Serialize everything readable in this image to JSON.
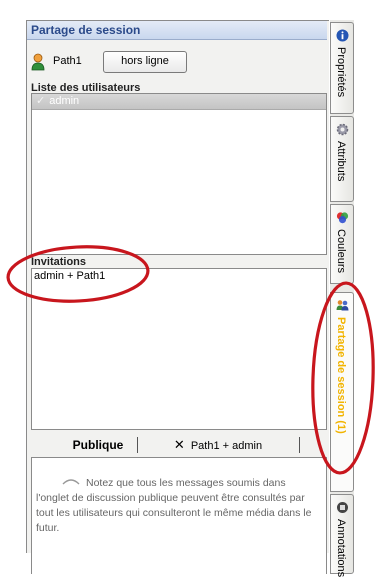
{
  "panel": {
    "title": "Partage de session",
    "user_name": "Path1",
    "status_button": "hors ligne",
    "users_label": "Liste des utilisateurs",
    "users": [
      {
        "name": "admin"
      }
    ],
    "invitations_label": "Invitations",
    "invitations": [
      "admin + Path1"
    ]
  },
  "chat": {
    "tab_public": "Publique",
    "tab_private": "Path1 + admin",
    "notice": "Notez que tous les messages soumis dans l'onglet de discussion publique peuvent être consultés par tout les utilisateurs qui consulteront le même média dans le futur."
  },
  "sidebar_tabs": [
    {
      "label": "Propriétés",
      "icon": "info-icon"
    },
    {
      "label": "Attributs",
      "icon": "gear-icon"
    },
    {
      "label": "Couleurs",
      "icon": "color-palette-icon"
    },
    {
      "label": "Partage de session (1)",
      "icon": "users-icon",
      "active": true
    },
    {
      "label": "Annotations",
      "icon": "annotation-icon"
    }
  ],
  "colors": {
    "annotation_red": "#c8161d",
    "active_tab_text": "#f2b400",
    "title_text": "#2b4a8a"
  }
}
